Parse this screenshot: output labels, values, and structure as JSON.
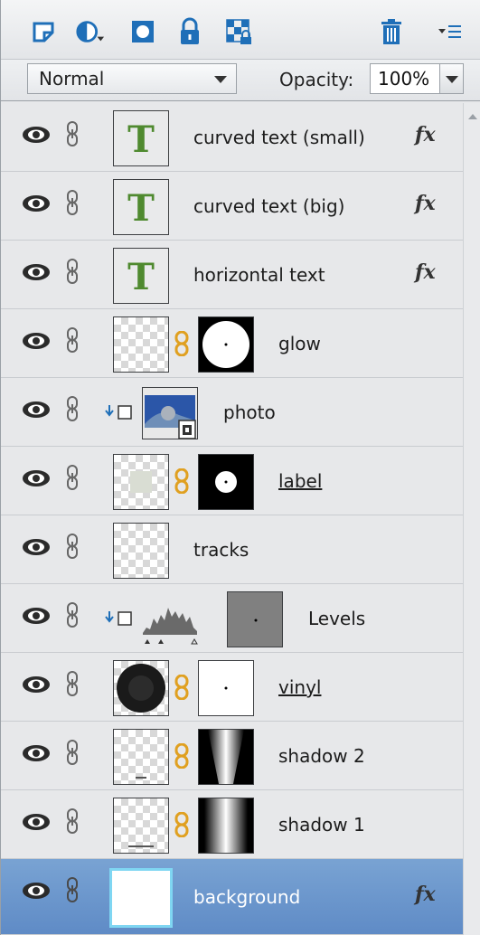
{
  "toolbar": {
    "icons": [
      "new-layer-icon",
      "adjustment-layer-icon",
      "layer-mask-icon",
      "lock-icon",
      "lock-transparency-icon",
      "trash-icon",
      "panel-menu-icon"
    ]
  },
  "blend": {
    "mode": "Normal",
    "opacity_label": "Opacity:",
    "opacity_value": "100%"
  },
  "layers": [
    {
      "name": "curved text (small)",
      "type": "text",
      "fx": "fx"
    },
    {
      "name": "curved text (big)",
      "type": "text",
      "fx": "fx"
    },
    {
      "name": "horizontal text",
      "type": "text",
      "fx": "fx"
    },
    {
      "name": "glow",
      "type": "masked"
    },
    {
      "name": "photo",
      "type": "clipped-smart"
    },
    {
      "name": "label",
      "type": "masked"
    },
    {
      "name": "tracks",
      "type": "plain"
    },
    {
      "name": "Levels",
      "type": "adjustment"
    },
    {
      "name": "vinyl",
      "type": "masked"
    },
    {
      "name": "shadow 2",
      "type": "masked"
    },
    {
      "name": "shadow 1",
      "type": "masked"
    },
    {
      "name": "background",
      "type": "background",
      "fx": "fx",
      "selected": true
    }
  ],
  "colors": {
    "selected_row": "#6e97cd",
    "text_thumb_green": "#4f8a2f",
    "link_gold": "#e0a020",
    "toolbar_blue": "#1f6fb8"
  }
}
